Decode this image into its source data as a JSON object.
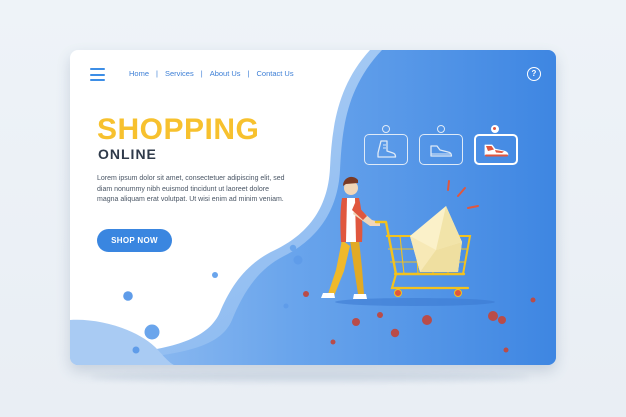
{
  "nav": {
    "links": [
      {
        "label": "Home"
      },
      {
        "label": "Services"
      },
      {
        "label": "About Us"
      },
      {
        "label": "Contact Us"
      }
    ],
    "separator": "|",
    "help_icon": "help-circle-icon",
    "help_glyph": "?",
    "menu_icon": "hamburger-menu-icon"
  },
  "hero": {
    "title": "SHOPPING",
    "subtitle": "ONLINE",
    "body": "Lorem ipsum dolor sit amet, consectetuer adipiscing elit, sed diam nonummy nibh euismod tincidunt ut laoreet dolore magna aliquam erat volutpat. Ut wisi enim ad minim veniam.",
    "cta_label": "SHOP NOW"
  },
  "product_options": {
    "items": [
      {
        "icon": "boot-icon",
        "selected": false
      },
      {
        "icon": "sneaker-icon",
        "selected": false
      },
      {
        "icon": "red-sneaker-icon",
        "selected": true
      }
    ]
  },
  "colors": {
    "accent_blue": "#3a86e0",
    "panel_blue": "#5b9be9",
    "title_yellow": "#f7c12e",
    "cart_yellow": "#f3c21e",
    "shoe_red": "#e0573e"
  },
  "illustration": {
    "figure": "shopper-with-cart",
    "icons": [
      "shopping-cart-icon",
      "paper-bag-icon"
    ]
  }
}
